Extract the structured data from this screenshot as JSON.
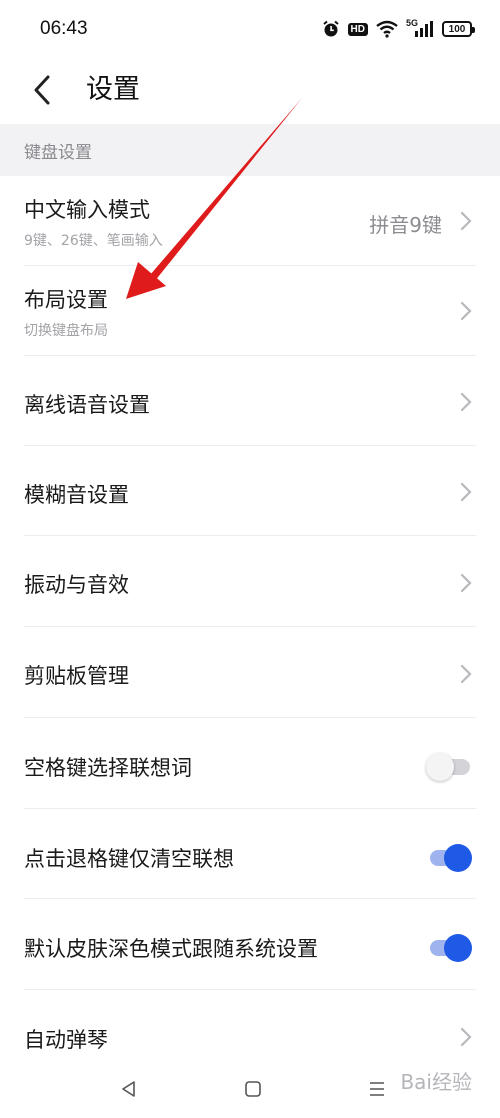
{
  "status_bar": {
    "time": "06:43",
    "hd_badge": "HD",
    "network_label": "5G",
    "battery_level": "100"
  },
  "header": {
    "title": "设置"
  },
  "section": {
    "label": "键盘设置"
  },
  "items": [
    {
      "title": "中文输入模式",
      "subtitle": "9键、26键、笔画输入",
      "value": "拼音9键",
      "control": "chevron"
    },
    {
      "title": "布局设置",
      "subtitle": "切换键盘布局",
      "control": "chevron"
    },
    {
      "title": "离线语音设置",
      "control": "chevron"
    },
    {
      "title": "模糊音设置",
      "control": "chevron"
    },
    {
      "title": "振动与音效",
      "control": "chevron"
    },
    {
      "title": "剪贴板管理",
      "control": "chevron"
    },
    {
      "title": "空格键选择联想词",
      "control": "toggle",
      "enabled": false
    },
    {
      "title": "点击退格键仅清空联想",
      "control": "toggle",
      "enabled": true
    },
    {
      "title": "默认皮肤深色模式跟随系统设置",
      "control": "toggle",
      "enabled": true
    },
    {
      "title": "自动弹琴",
      "control": "chevron"
    }
  ],
  "watermark": "Bai经验",
  "colors": {
    "accent": "#1e5ae6",
    "toggle_track_on": "#9fb4ef",
    "toggle_track_off": "#d4d4d8",
    "annotation_arrow": "#e01b1b",
    "section_bg": "#f2f2f5"
  },
  "icons": {
    "back": "chevron-left-icon",
    "row_arrow": "chevron-right-icon",
    "alarm": "alarm-icon",
    "wifi": "wifi-icon",
    "signal": "signal-icon",
    "battery": "battery-icon",
    "nav_back": "triangle-back-icon",
    "nav_home": "square-home-icon",
    "nav_menu": "menu-lines-icon"
  }
}
